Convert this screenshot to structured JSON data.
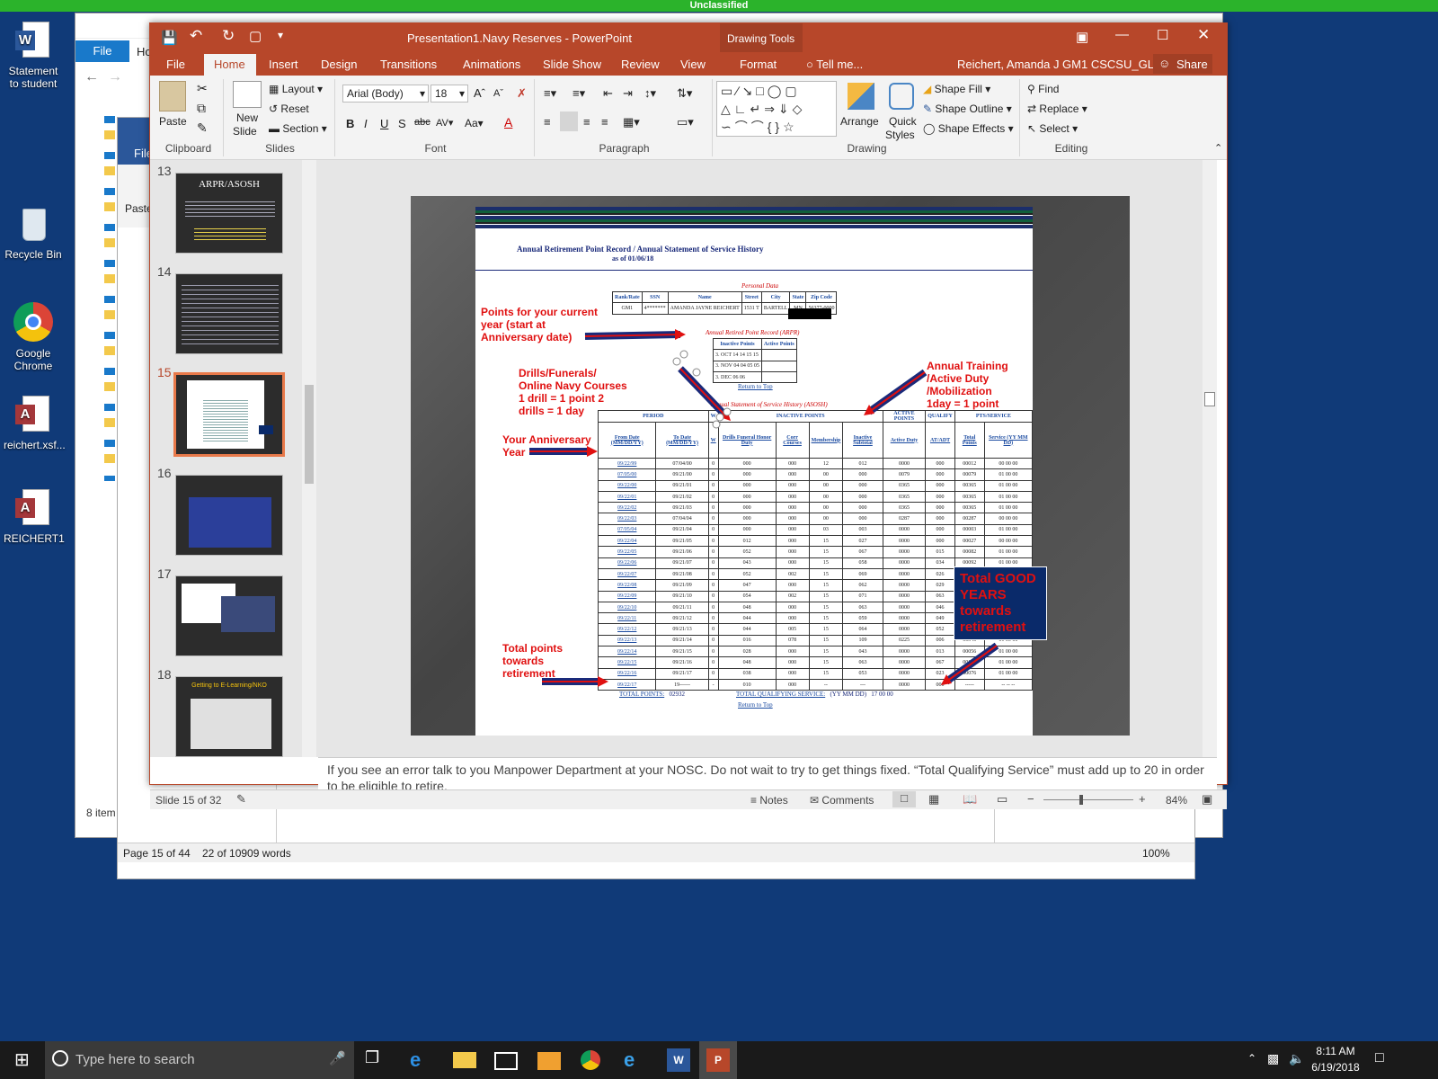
{
  "banner": {
    "text": "Unclassified"
  },
  "desktop": {
    "icons": [
      {
        "label": "Statement to student"
      },
      {
        "label": "Recycle Bin"
      },
      {
        "label": "Google Chrome"
      },
      {
        "label": "reichert.xsf..."
      },
      {
        "label": "REICHERT1"
      }
    ]
  },
  "explorer": {
    "file_tab": "File",
    "home_tab": "Ho",
    "item_count": "8 item"
  },
  "word": {
    "file_tab": "File",
    "paste": "Paste",
    "page_status": "Page 15 of 44",
    "word_count": "22 of 10909 words",
    "zoom": "100%"
  },
  "ppt": {
    "title": "Presentation1.Navy Reserves - PowerPoint",
    "drawing_tools": "Drawing Tools",
    "user": "Reichert, Amanda J GM1 CSCSU_GL, GM",
    "share": "Share",
    "tabs": [
      "File",
      "Home",
      "Insert",
      "Design",
      "Transitions",
      "Animations",
      "Slide Show",
      "Review",
      "View",
      "Format"
    ],
    "tell_me": "Tell me...",
    "ribbon": {
      "clipboard": {
        "label": "Clipboard",
        "paste": "Paste"
      },
      "slides": {
        "label": "Slides",
        "new_slide": "New",
        "new_slide2": "Slide",
        "layout": "Layout",
        "reset": "Reset",
        "section": "Section"
      },
      "font": {
        "label": "Font",
        "name": "Arial (Body)",
        "size": "18"
      },
      "paragraph": {
        "label": "Paragraph"
      },
      "drawing": {
        "label": "Drawing",
        "arrange": "Arrange",
        "quick_styles": "Quick",
        "quick_styles2": "Styles",
        "shape_fill": "Shape Fill",
        "shape_outline": "Shape Outline",
        "shape_effects": "Shape Effects"
      },
      "editing": {
        "label": "Editing",
        "find": "Find",
        "replace": "Replace",
        "select": "Select"
      }
    },
    "thumbnails": [
      {
        "num": "13",
        "title": "ARPR/ASOSH"
      },
      {
        "num": "14",
        "title": ""
      },
      {
        "num": "15",
        "title": ""
      },
      {
        "num": "16",
        "title": ""
      },
      {
        "num": "17",
        "title": ""
      },
      {
        "num": "18",
        "title": "Getting to E-Learning/NKO"
      }
    ],
    "notes": "If you see an error talk to you Manpower Department at your NOSC.  Do not wait to try to get things fixed.  “Total Qualifying Service” must add up to 20  in order to be eligible to retire.",
    "status": {
      "slide": "Slide 15 of 32",
      "notes": "Notes",
      "comments": "Comments",
      "zoom": "84%"
    }
  },
  "slide": {
    "doc_title": "Annual Retirement Point Record / Annual Statement of Service History",
    "as_of": "as of  01/06/18",
    "personal_data": "Personal Data",
    "personal_headers": [
      "Rank/Rate",
      "SSN",
      "Name",
      "Street",
      "City",
      "State",
      "Zip Code"
    ],
    "personal_row": [
      "GM1",
      "4*******",
      "AMANDA JAYNE REICHERT",
      "1531 T",
      "BARTELL",
      "MN",
      "56377-0000"
    ],
    "arpr_title": "Annual Retired Point Record (ARPR)",
    "arpr_headers": [
      "Inactive Points",
      "Active Points"
    ],
    "arpr_rows": [
      [
        "3. OCT 14 14 15 15",
        ""
      ],
      [
        "3. NOV 04 04 05 05",
        ""
      ],
      [
        "3. DEC 06 06",
        ""
      ]
    ],
    "return_top": "Return to Top",
    "asosh_title": "Annual Statement of Service History (ASOSH)",
    "asosh_groups": [
      "PERIOD",
      "W",
      "INACTIVE POINTS",
      "ACTIVE POINTS",
      "QUALIFY",
      "PTS/SERVICE"
    ],
    "asosh_cols": [
      "From Date (MM/DD/YY)",
      "To Date (MM/DD/YY)",
      "W",
      "Drills Funeral Honor Duty",
      "Corr Courses",
      "Membership",
      "Inactive Subtotal",
      "Active Duty",
      "AT/ADT",
      "Total Points",
      "Service (YY MM DD)"
    ],
    "asosh_rows": [
      [
        "09/22/99",
        "07/04/00",
        "0",
        "000",
        "000",
        "12",
        "012",
        "0000",
        "000",
        "00012",
        "00 00 00"
      ],
      [
        "07/05/00",
        "09/21/00",
        "0",
        "000",
        "000",
        "00",
        "000",
        "0079",
        "000",
        "00079",
        "01 00 00"
      ],
      [
        "09/22/00",
        "09/21/01",
        "0",
        "000",
        "000",
        "00",
        "000",
        "0365",
        "000",
        "00365",
        "01 00 00"
      ],
      [
        "09/22/01",
        "09/21/02",
        "0",
        "000",
        "000",
        "00",
        "000",
        "0365",
        "000",
        "00365",
        "01 00 00"
      ],
      [
        "09/22/02",
        "09/21/03",
        "0",
        "000",
        "000",
        "00",
        "000",
        "0365",
        "000",
        "00365",
        "01 00 00"
      ],
      [
        "09/22/03",
        "07/04/04",
        "0",
        "000",
        "000",
        "00",
        "000",
        "0287",
        "000",
        "00287",
        "00 00 00"
      ],
      [
        "07/05/04",
        "09/21/04",
        "0",
        "000",
        "000",
        "03",
        "003",
        "0000",
        "000",
        "00003",
        "01 00 00"
      ],
      [
        "09/22/04",
        "09/21/05",
        "0",
        "012",
        "000",
        "15",
        "027",
        "0000",
        "000",
        "00027",
        "00 00 00"
      ],
      [
        "09/22/05",
        "09/21/06",
        "0",
        "052",
        "000",
        "15",
        "067",
        "0000",
        "015",
        "00082",
        "01 00 00"
      ],
      [
        "09/22/06",
        "09/21/07",
        "0",
        "043",
        "000",
        "15",
        "058",
        "0000",
        "034",
        "00092",
        "01 00 00"
      ],
      [
        "09/22/07",
        "09/21/08",
        "0",
        "052",
        "002",
        "15",
        "069",
        "0000",
        "026",
        "00095",
        "01 00 00"
      ],
      [
        "09/22/08",
        "09/21/09",
        "0",
        "047",
        "000",
        "15",
        "062",
        "0000",
        "029",
        "00091",
        "01 00 00"
      ],
      [
        "09/22/09",
        "09/21/10",
        "0",
        "054",
        "002",
        "15",
        "071",
        "0000",
        "063",
        "00134",
        "01 00 00"
      ],
      [
        "09/22/10",
        "09/21/11",
        "0",
        "048",
        "000",
        "15",
        "063",
        "0000",
        "046",
        "00109",
        "01 00 00"
      ],
      [
        "09/22/11",
        "09/21/12",
        "0",
        "044",
        "000",
        "15",
        "059",
        "0000",
        "049",
        "00108",
        "01 00 00"
      ],
      [
        "09/22/12",
        "09/21/13",
        "0",
        "044",
        "005",
        "15",
        "064",
        "0000",
        "052",
        "00116",
        "01 00 00"
      ],
      [
        "09/22/13",
        "09/21/14",
        "0",
        "016",
        "078",
        "15",
        "109",
        "0225",
        "006",
        "00340",
        "01 00 00"
      ],
      [
        "09/22/14",
        "09/21/15",
        "0",
        "028",
        "000",
        "15",
        "043",
        "0000",
        "013",
        "00056",
        "01 00 00"
      ],
      [
        "09/22/15",
        "09/21/16",
        "0",
        "048",
        "000",
        "15",
        "063",
        "0000",
        "067",
        "00130",
        "01 00 00"
      ],
      [
        "09/22/16",
        "09/21/17",
        "0",
        "038",
        "000",
        "15",
        "053",
        "0000",
        "023",
        "00076",
        "01 00 00"
      ],
      [
        "09/22/17",
        "19------",
        "-",
        "010",
        "000",
        "--",
        "---",
        "0000",
        "000",
        "-----",
        "-- -- --"
      ]
    ],
    "total_points_label": "TOTAL POINTS:",
    "total_points": "02932",
    "total_qual_label": "TOTAL QUALIFYING SERVICE:",
    "total_qual_unit": "(YY MM DD)",
    "total_qual": "17 00 00",
    "callouts": {
      "points_current": "Points for your current year (start at Anniversary date)",
      "drills": "Drills/Funerals/ Online Navy Courses 1 drill = 1 point 2 drills = 1 day",
      "anniversary": "Your Anniversary Year",
      "annual_training": "Annual Training /Active Duty /Mobilization 1day = 1 point",
      "good_years": "Total GOOD YEARS towards retirement",
      "total_points": "Total points towards retirement"
    }
  },
  "taskbar": {
    "search_placeholder": "Type here to search",
    "time": "8:11 AM",
    "date": "6/19/2018"
  },
  "colors": {
    "ppt_accent": "#b7472a",
    "desktop": "#103a78",
    "banner": "#2bb32b",
    "callout": "#e01010",
    "navy": "#0a2a6a"
  }
}
